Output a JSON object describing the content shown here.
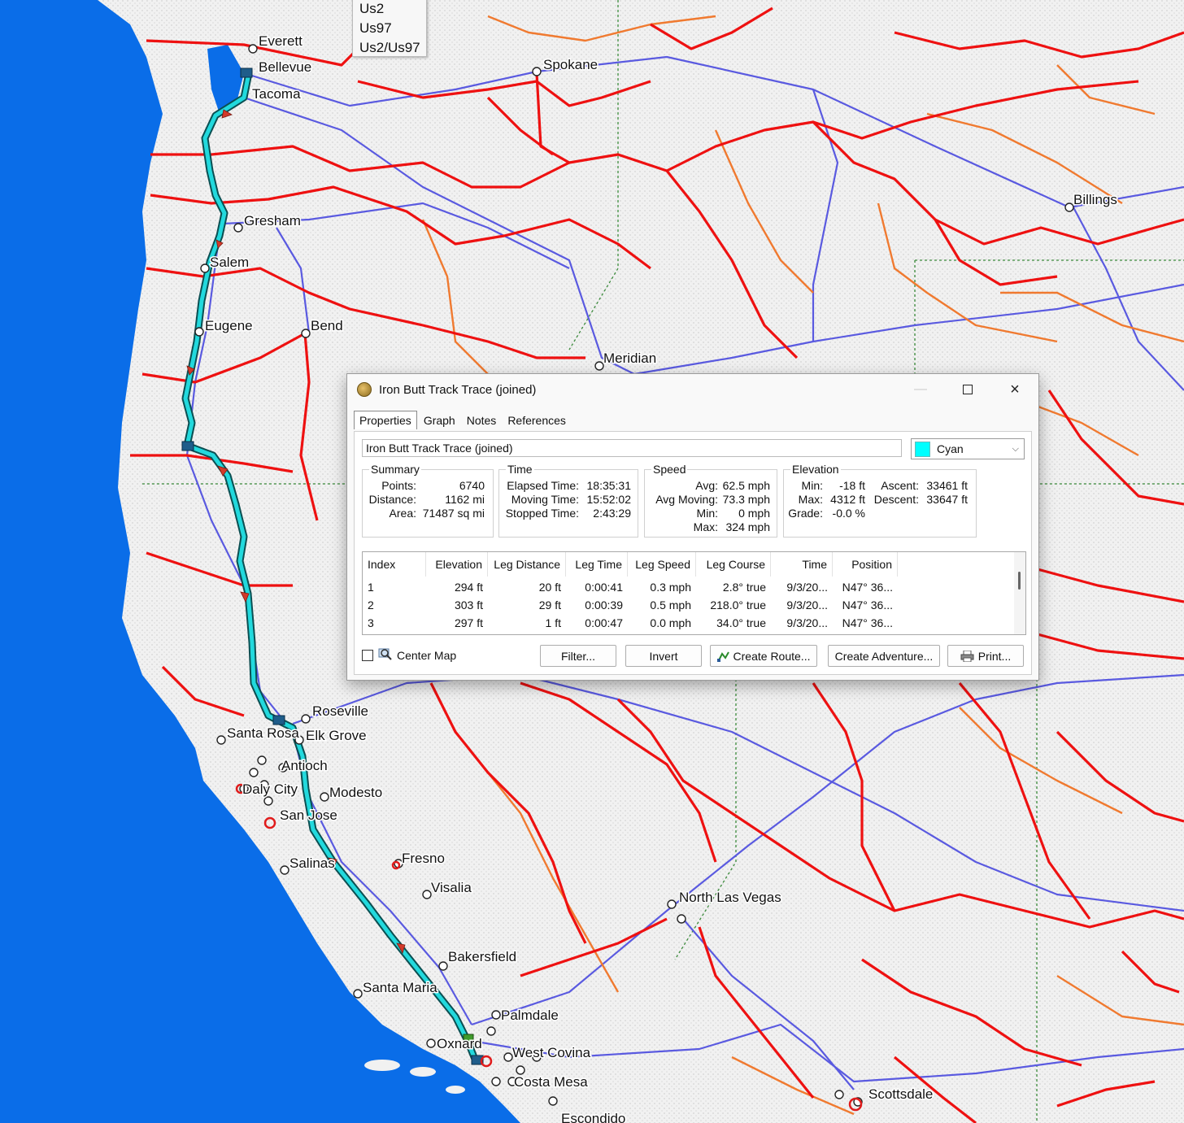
{
  "map": {
    "cities": [
      {
        "name": "Everett"
      },
      {
        "name": "Bellevue"
      },
      {
        "name": "Tacoma"
      },
      {
        "name": "Spokane"
      },
      {
        "name": "Billings"
      },
      {
        "name": "Gresham"
      },
      {
        "name": "Salem"
      },
      {
        "name": "Eugene"
      },
      {
        "name": "Bend"
      },
      {
        "name": "Meridian"
      },
      {
        "name": "Roseville"
      },
      {
        "name": "Santa Rosa"
      },
      {
        "name": "Elk Grove"
      },
      {
        "name": "Antioch"
      },
      {
        "name": "Daly City"
      },
      {
        "name": "Modesto"
      },
      {
        "name": "San Jose"
      },
      {
        "name": "Salinas"
      },
      {
        "name": "Fresno"
      },
      {
        "name": "Visalia"
      },
      {
        "name": "North Las Vegas"
      },
      {
        "name": "Bakersfield"
      },
      {
        "name": "Santa Maria"
      },
      {
        "name": "Palmdale"
      },
      {
        "name": "Oxnard"
      },
      {
        "name": "West Covina"
      },
      {
        "name": "Costa Mesa"
      },
      {
        "name": "Escondido"
      },
      {
        "name": "Scottsdale"
      }
    ],
    "tooltip_lines": [
      "Us2",
      "Us97",
      "Us2/Us97"
    ],
    "track_color": "#22d9dd",
    "highway_color": "#ee1111",
    "state_road_color": "#f07a30",
    "interstate_color": "#5a5ae0",
    "water_color": "#0a6de8"
  },
  "dialog": {
    "title": "Iron Butt Track Trace (joined)",
    "tabs": [
      "Properties",
      "Graph",
      "Notes",
      "References"
    ],
    "name_value": "Iron Butt Track Trace (joined)",
    "color": {
      "label": "Cyan",
      "hex": "#00ffff"
    },
    "summary": {
      "legend": "Summary",
      "rows": [
        {
          "k": "Points:",
          "v": "6740"
        },
        {
          "k": "Distance:",
          "v": "1162 mi"
        },
        {
          "k": "Area:",
          "v": "71487 sq mi"
        }
      ]
    },
    "time": {
      "legend": "Time",
      "rows": [
        {
          "k": "Elapsed Time:",
          "v": "18:35:31"
        },
        {
          "k": "Moving Time:",
          "v": "15:52:02"
        },
        {
          "k": "Stopped Time:",
          "v": "2:43:29"
        }
      ]
    },
    "speed": {
      "legend": "Speed",
      "rows": [
        {
          "k": "Avg:",
          "v": "62.5 mph"
        },
        {
          "k": "Avg Moving:",
          "v": "73.3 mph"
        },
        {
          "k": "Min:",
          "v": "0 mph"
        },
        {
          "k": "Max:",
          "v": "324 mph"
        }
      ]
    },
    "elevation": {
      "legend": "Elevation",
      "rows": [
        {
          "k": "Min:",
          "v": "-18 ft"
        },
        {
          "k": "Max:",
          "v": "4312 ft"
        },
        {
          "k": "Grade:",
          "v": "-0.0 %"
        }
      ],
      "rows2": [
        {
          "k": "Ascent:",
          "v": "33461 ft"
        },
        {
          "k": "Descent:",
          "v": "33647 ft"
        }
      ]
    },
    "table": {
      "columns": [
        "Index",
        "Elevation",
        "Leg Distance",
        "Leg Time",
        "Leg Speed",
        "Leg Course",
        "Time",
        "Position"
      ],
      "rows": [
        [
          "1",
          "294 ft",
          "20 ft",
          "0:00:41",
          "0.3 mph",
          "2.8° true",
          "9/3/20...",
          "N47° 36..."
        ],
        [
          "2",
          "303 ft",
          "29 ft",
          "0:00:39",
          "0.5 mph",
          "218.0° true",
          "9/3/20...",
          "N47° 36..."
        ],
        [
          "3",
          "297 ft",
          "1 ft",
          "0:00:47",
          "0.0 mph",
          "34.0° true",
          "9/3/20...",
          "N47° 36..."
        ]
      ]
    },
    "center_map_label": "Center Map",
    "buttons": {
      "filter": "Filter...",
      "invert": "Invert",
      "create_route": "Create Route...",
      "create_adventure": "Create Adventure...",
      "print": "Print..."
    }
  }
}
